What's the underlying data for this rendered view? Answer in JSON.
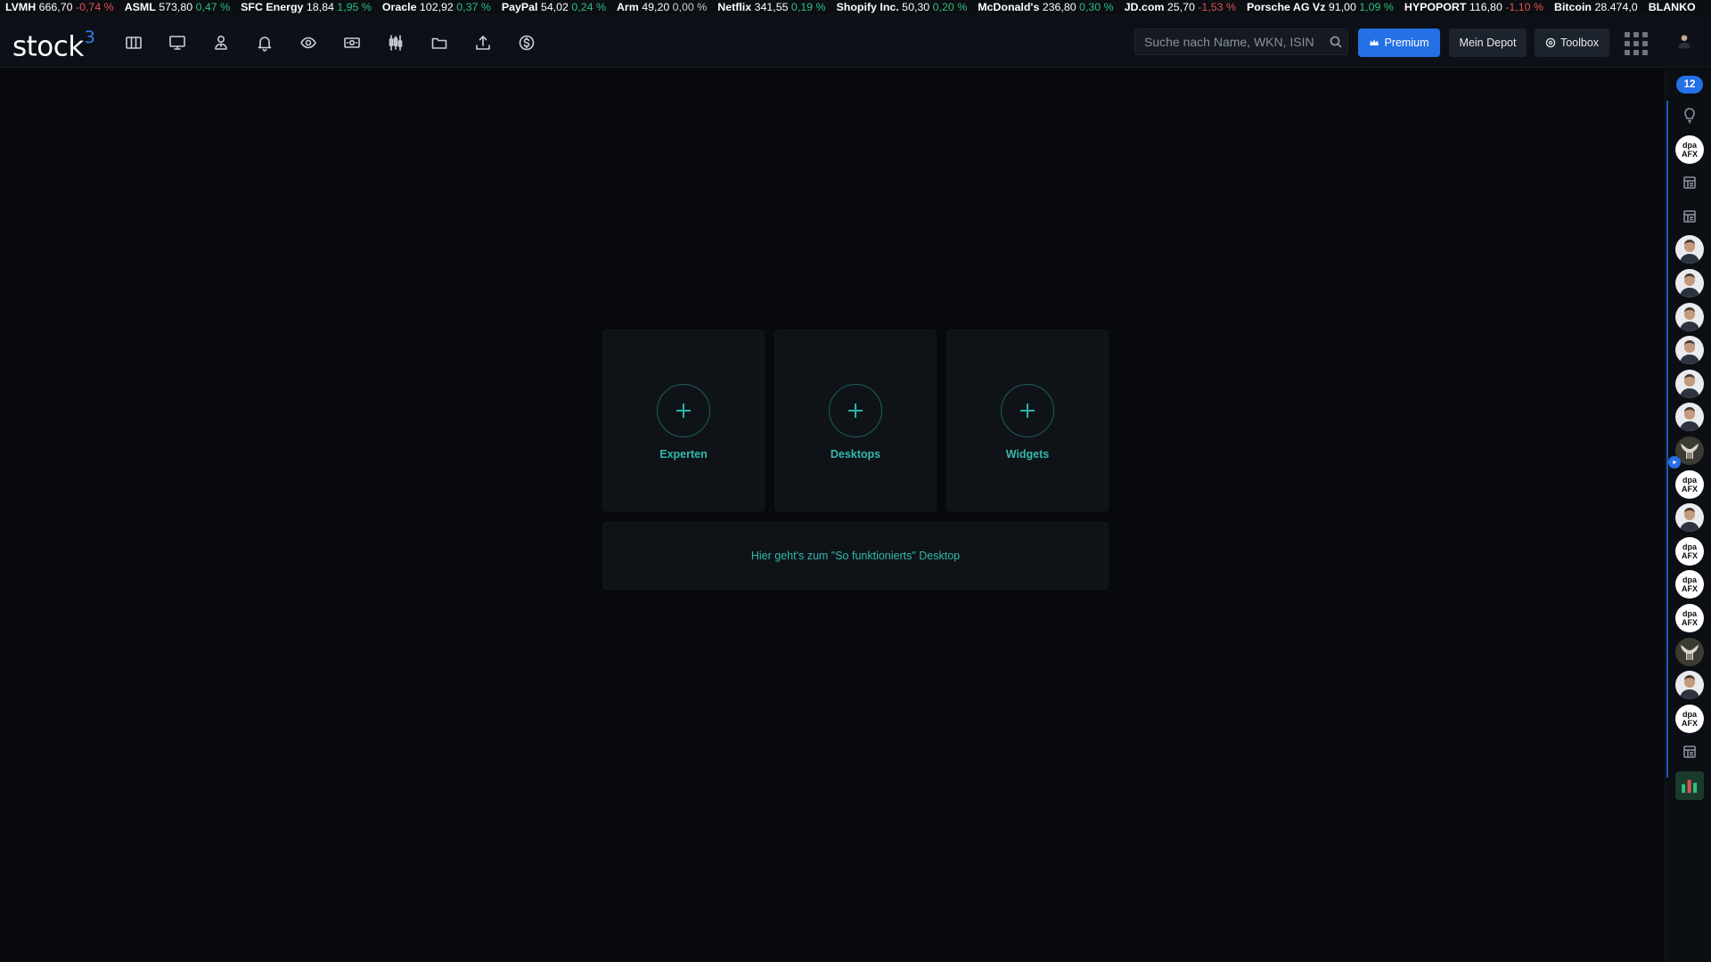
{
  "ticker": [
    {
      "name": "LVMH",
      "price": "666,70",
      "change": "-0,74 %",
      "dir": "down"
    },
    {
      "name": "ASML",
      "price": "573,80",
      "change": "0,47 %",
      "dir": "up"
    },
    {
      "name": "SFC Energy",
      "price": "18,84",
      "change": "1,95 %",
      "dir": "up"
    },
    {
      "name": "Oracle",
      "price": "102,92",
      "change": "0,37 %",
      "dir": "up"
    },
    {
      "name": "PayPal",
      "price": "54,02",
      "change": "0,24 %",
      "dir": "up"
    },
    {
      "name": "Arm",
      "price": "49,20",
      "change": "0,00 %",
      "dir": "flat"
    },
    {
      "name": "Netflix",
      "price": "341,55",
      "change": "0,19 %",
      "dir": "up"
    },
    {
      "name": "Shopify Inc.",
      "price": "50,30",
      "change": "0,20 %",
      "dir": "up"
    },
    {
      "name": "McDonald's",
      "price": "236,80",
      "change": "0,30 %",
      "dir": "up"
    },
    {
      "name": "JD.com",
      "price": "25,70",
      "change": "-1,53 %",
      "dir": "down"
    },
    {
      "name": "Porsche AG Vz",
      "price": "91,00",
      "change": "1,09 %",
      "dir": "up"
    },
    {
      "name": "HYPOPORT",
      "price": "116,80",
      "change": "-1,10 %",
      "dir": "down"
    },
    {
      "name": "Bitcoin",
      "price": "28.474,0",
      "change": "",
      "dir": "flat"
    },
    {
      "name": "BLANKO",
      "price": "",
      "change": "",
      "dir": "flat"
    }
  ],
  "header": {
    "logo_text": "stock",
    "logo_sup": "3",
    "nav_icons": [
      "columns-icon",
      "monitor-icon",
      "person-icon",
      "bell-icon",
      "eye-icon",
      "money-icon",
      "candlestick-icon",
      "folder-icon",
      "upload-icon",
      "dollar-icon"
    ],
    "search_placeholder": "Suche nach Name, WKN, ISIN",
    "premium_label": "Premium",
    "depot_label": "Mein Depot",
    "toolbox_label": "Toolbox"
  },
  "main": {
    "tiles": [
      {
        "label": "Experten"
      },
      {
        "label": "Desktops"
      },
      {
        "label": "Widgets"
      }
    ],
    "howto_text": "Hier geht's zum \"So funktionierts\" Desktop"
  },
  "sidebar": {
    "badge": "12",
    "items": [
      "bulb-icon",
      "dpa",
      "doc-icon",
      "doc-icon",
      "person",
      "person",
      "person",
      "person",
      "person",
      "person",
      "bull",
      "dpa",
      "person",
      "dpa",
      "dpa",
      "dpa",
      "bull",
      "person",
      "dpa",
      "doc-icon",
      "chart-thumb"
    ],
    "dpa_line1": "dpa",
    "dpa_line2": "AFX"
  },
  "colors": {
    "accent": "#2470e6",
    "teal": "#33b8ad",
    "up": "#2fbf7e",
    "down": "#e0524f",
    "background": "#07090d"
  }
}
